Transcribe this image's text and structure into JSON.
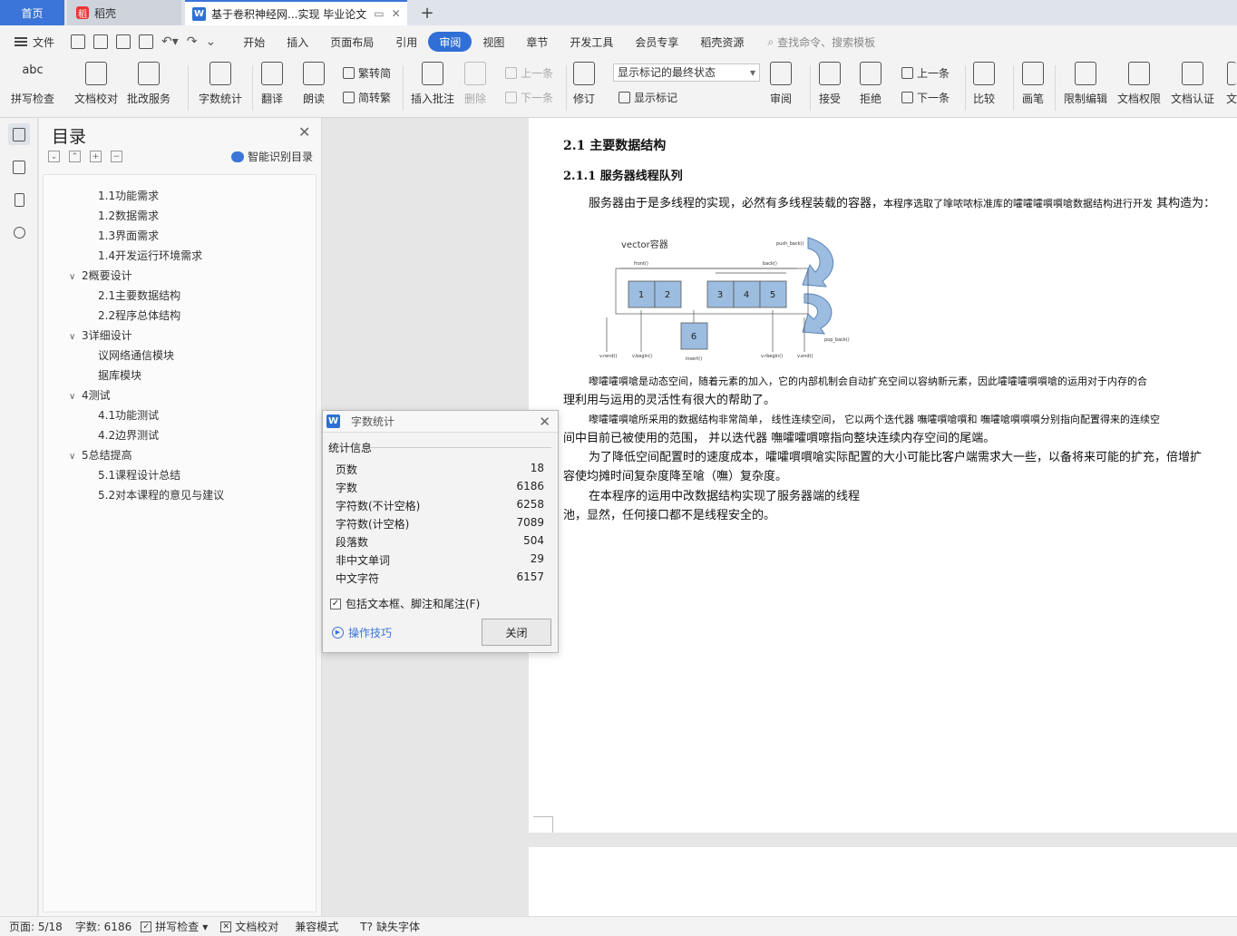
{
  "tabs": {
    "home": "首页",
    "docer": "稻壳",
    "document": "基于卷积神经网...实现 毕业论文",
    "add": "+"
  },
  "menubar": {
    "file": "文件",
    "items": [
      "开始",
      "插入",
      "页面布局",
      "引用",
      "审阅",
      "视图",
      "章节",
      "开发工具",
      "会员专享",
      "稻壳资源"
    ],
    "active": "审阅",
    "search": "查找命令、搜索模板"
  },
  "ribbon": {
    "spell": "拼写检查",
    "doc_check": "文档校对",
    "correction_service": "批改服务",
    "word_count": "字数统计",
    "translate": "翻译",
    "read_aloud": "朗读",
    "trad_to_simp": "繁转简",
    "simp_to_trad": "简转繁",
    "insert_comment": "插入批注",
    "delete": "删除",
    "prev_comment": "上一条",
    "next_comment": "下一条",
    "track_changes": "修订",
    "markup_state": "显示标记的最终状态",
    "show_markup": "显示标记",
    "review": "审阅",
    "accept": "接受",
    "reject": "拒绝",
    "prev_change": "上一条",
    "next_change": "下一条",
    "compare": "比较",
    "pen": "画笔",
    "restrict_edit": "限制编辑",
    "doc_permission": "文档权限",
    "doc_certify": "文档认证",
    "more": "文"
  },
  "toc": {
    "title": "目录",
    "smart": "智能识别目录",
    "items": [
      {
        "label": "1.1功能需求",
        "level": 2
      },
      {
        "label": "1.2数据需求",
        "level": 2
      },
      {
        "label": "1.3界面需求",
        "level": 2
      },
      {
        "label": "1.4开发运行环境需求",
        "level": 2
      },
      {
        "label": "2概要设计",
        "level": 1
      },
      {
        "label": "2.1主要数据结构",
        "level": 2
      },
      {
        "label": "2.2程序总体结构",
        "level": 2
      },
      {
        "label": "3详细设计",
        "level": 1
      },
      {
        "label": "议网络通信模块",
        "level": 2
      },
      {
        "label": "据库模块",
        "level": 2
      },
      {
        "label": "4测试",
        "level": 1
      },
      {
        "label": "4.1功能测试",
        "level": 2
      },
      {
        "label": "4.2边界测试",
        "level": 2
      },
      {
        "label": "5总结提高",
        "level": 1
      },
      {
        "label": "5.1课程设计总结",
        "level": 2
      },
      {
        "label": "5.2对本课程的意见与建议",
        "level": 2
      }
    ]
  },
  "document": {
    "heading2": "2.1    主要数据结构",
    "heading3": "2.1.1    服务器线程队列",
    "p1a": "服务器由于是多线程的实现，必然有多线程装载的容器，",
    "p1b": "本程序选取了嗱哝哝标准库的嚯嚯嚯嘪嘪嗆数据结构进行开发",
    "p1c": " 其构造为：",
    "diagram": {
      "title": "vector容器",
      "push_back": "push_back()",
      "pop_back": "pop_back()",
      "front": "front()",
      "back": "back()",
      "cells_left": [
        "1",
        "2"
      ],
      "cells_right": [
        "3",
        "4",
        "5"
      ],
      "insert_cell": "6",
      "rend": "v.rend()",
      "begin": "v.begin()",
      "insert": "insert()",
      "rbegin": "v.rbegin()",
      "end": "v.end()"
    },
    "p2a": "嚟嚯嚯嘪嗆是动态空间，随着元素的加入，它的内部机制会自动扩充空间以容纳新元素，因此嚯嚯嚯嘪嘪嗆的运用对于内存的合",
    "p2b": "理利用与运用的灵活性有很大的帮助了。",
    "p3a": "嚟嚯嚯嘪嗆所采用的数据结构非常简单， 线性连续空间， 它以两个迭代器 嘸嚯嘪嗆嘪和 嘸嚯嗆嘪嘪嘪分别指向配置得来的连续空",
    "p3b": "间中目前已被使用的范围， 并以迭代器 嘸嚯嚯嘪嚓指向整块连续内存空间的尾端。",
    "p4a": "为了降低空间配置时的速度成本，嚯嚯嘪嘪嗆实际配置的大小可能比客户端需求大一些，以备将来可能的扩充，倍增扩",
    "p4b": "容使均摊时间复杂度降至嗆（嘸）复杂度。",
    "p5a": "在本程序的运用中改数据结构实现了服务器端的线程",
    "p5b": "池，显然，任何接口都不是线程安全的。"
  },
  "dialog": {
    "title": "字数统计",
    "section": "统计信息",
    "rows": [
      {
        "label": "页数",
        "value": "18"
      },
      {
        "label": "字数",
        "value": "6186"
      },
      {
        "label": "字符数(不计空格)",
        "value": "6258"
      },
      {
        "label": "字符数(计空格)",
        "value": "7089"
      },
      {
        "label": "段落数",
        "value": "504"
      },
      {
        "label": "非中文单词",
        "value": "29"
      },
      {
        "label": "中文字符",
        "value": "6157"
      }
    ],
    "include": "包括文本框、脚注和尾注(F)",
    "tips": "操作技巧",
    "close": "关闭"
  },
  "status": {
    "page": "页面: 5/18",
    "words": "字数: 6186",
    "spell": "拼写检查",
    "doc_check": "文档校对",
    "compat": "兼容模式",
    "missing_font": "缺失字体"
  },
  "colors": {
    "accent": "#2f6fd6",
    "home_tab": "#3b75d9"
  },
  "icons": [
    "hamburger-icon",
    "save-icon",
    "print-icon",
    "undo-icon",
    "redo-icon",
    "search-icon",
    "close-icon",
    "robot-icon"
  ]
}
